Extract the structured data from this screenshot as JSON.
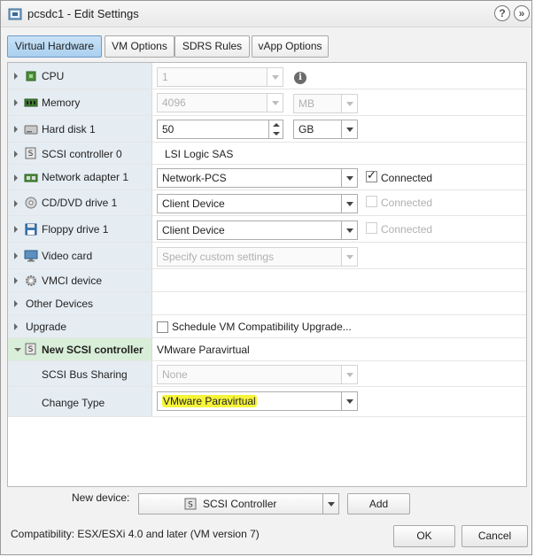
{
  "window": {
    "title": "pcsdc1 - Edit Settings",
    "help_glyph": "?",
    "close_glyph": "»"
  },
  "tabs": [
    {
      "label": "Virtual Hardware",
      "active": true
    },
    {
      "label": "VM Options",
      "active": false
    },
    {
      "label": "SDRS Rules",
      "active": false
    },
    {
      "label": "vApp Options",
      "active": false
    }
  ],
  "hardware": {
    "cpu": {
      "label": "CPU",
      "value": "1",
      "icon": "cpu-chip-icon",
      "info_glyph": "i"
    },
    "memory": {
      "label": "Memory",
      "value": "4096",
      "unit": "MB",
      "icon": "memory-module-icon"
    },
    "hard_disk": {
      "label": "Hard disk 1",
      "value": "50",
      "unit": "GB",
      "icon": "hard-disk-icon"
    },
    "scsi_controller": {
      "label": "SCSI controller 0",
      "value": "LSI Logic SAS",
      "icon": "scsi-controller-icon"
    },
    "network_adapter": {
      "label": "Network adapter 1",
      "value": "Network-PCS",
      "connected_label": "Connected",
      "connected": true,
      "icon": "network-adapter-icon"
    },
    "cd_dvd": {
      "label": "CD/DVD drive 1",
      "value": "Client Device",
      "connected_label": "Connected",
      "connected": false,
      "icon": "cd-dvd-icon"
    },
    "floppy": {
      "label": "Floppy drive 1",
      "value": "Client Device",
      "connected_label": "Connected",
      "connected": false,
      "icon": "floppy-icon"
    },
    "video_card": {
      "label": "Video card",
      "value": "Specify custom settings",
      "icon": "video-card-icon"
    },
    "vmci": {
      "label": "VMCI device",
      "icon": "vmci-gear-icon"
    },
    "other_devices": {
      "label": "Other Devices"
    },
    "upgrade": {
      "label": "Upgrade",
      "checkbox_label": "Schedule VM Compatibility Upgrade...",
      "checked": false
    },
    "new_scsi": {
      "label": "New SCSI controller",
      "value": "VMware Paravirtual",
      "icon": "scsi-controller-icon",
      "bus_sharing_label": "SCSI Bus Sharing",
      "bus_sharing_value": "None",
      "change_type_label": "Change Type",
      "change_type_value": "VMware Paravirtual",
      "highlight_color": "#f6f43a"
    }
  },
  "footer": {
    "new_device_label": "New device:",
    "new_device_value": "SCSI Controller",
    "add_label": "Add",
    "compatibility": "Compatibility: ESX/ESXi 4.0 and later (VM version 7)",
    "ok_label": "OK",
    "cancel_label": "Cancel"
  },
  "colors": {
    "active_tab": "#a9d0ef",
    "label_column": "#e5edf3",
    "selected_row": "#d9eed9"
  }
}
